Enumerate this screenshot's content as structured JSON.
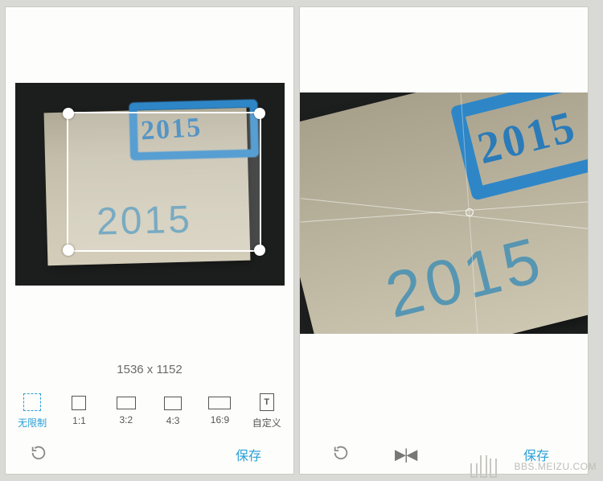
{
  "image_content": {
    "marker_text": "2015",
    "printed_text": "2015"
  },
  "left": {
    "crop_dimensions": "1536 x 1152",
    "ratios": [
      {
        "key": "free",
        "label": "无限制",
        "active": true
      },
      {
        "key": "1_1",
        "label": "1:1",
        "active": false
      },
      {
        "key": "3_2",
        "label": "3:2",
        "active": false
      },
      {
        "key": "4_3",
        "label": "4:3",
        "active": false
      },
      {
        "key": "16_9",
        "label": "16:9",
        "active": false
      },
      {
        "key": "custom",
        "label": "自定义",
        "active": false
      }
    ],
    "save_label": "保存"
  },
  "right": {
    "save_label": "保存"
  },
  "watermark": "BBS.MEIZU.COM"
}
